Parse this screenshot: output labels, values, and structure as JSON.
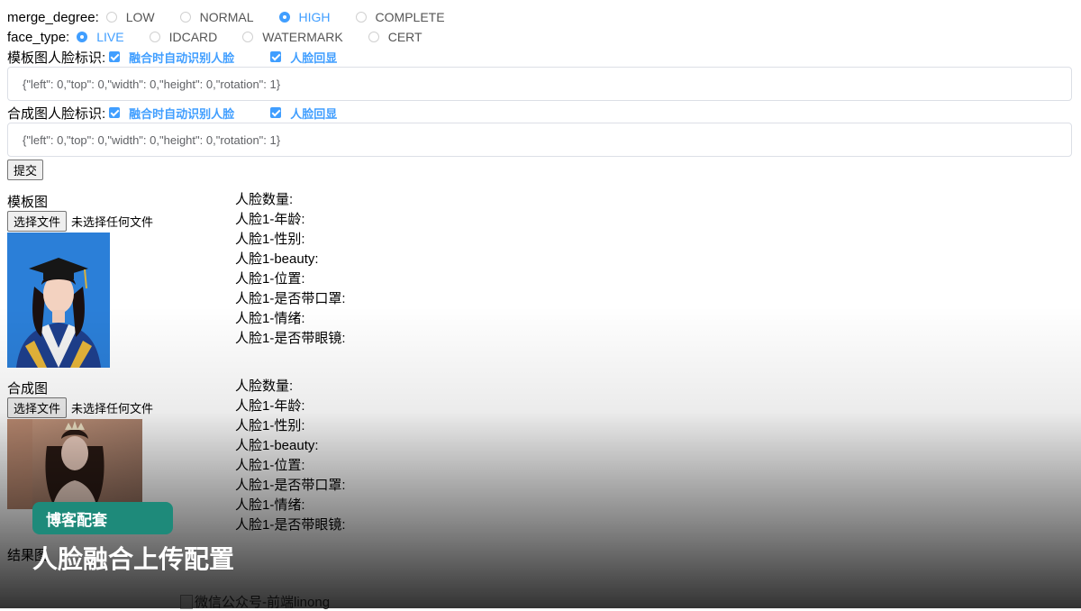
{
  "merge_degree": {
    "label": "merge_degree:",
    "options": [
      {
        "label": "LOW",
        "checked": false
      },
      {
        "label": "NORMAL",
        "checked": false
      },
      {
        "label": "HIGH",
        "checked": true
      },
      {
        "label": "COMPLETE",
        "checked": false
      }
    ]
  },
  "face_type": {
    "label": "face_type:",
    "options": [
      {
        "label": "LIVE",
        "checked": true
      },
      {
        "label": "IDCARD",
        "checked": false
      },
      {
        "label": "WATERMARK",
        "checked": false
      },
      {
        "label": "CERT",
        "checked": false
      }
    ]
  },
  "template_face": {
    "label": "模板图人脸标识:",
    "auto_detect": "融合时自动识别人脸",
    "echo": "人脸回显",
    "value": "{\"left\": 0,\"top\": 0,\"width\": 0,\"height\": 0,\"rotation\": 1}"
  },
  "merge_face": {
    "label": "合成图人脸标识:",
    "auto_detect": "融合时自动识别人脸",
    "echo": "人脸回显",
    "value": "{\"left\": 0,\"top\": 0,\"width\": 0,\"height\": 0,\"rotation\": 1}"
  },
  "submit_label": "提交",
  "template_image": {
    "title": "模板图",
    "file_button": "选择文件",
    "file_status": "未选择任何文件"
  },
  "merge_image": {
    "title": "合成图",
    "file_button": "选择文件",
    "file_status": "未选择任何文件"
  },
  "face_info_labels": [
    "人脸数量:",
    "人脸1-年龄:",
    "人脸1-性别:",
    "人脸1-beauty:",
    "人脸1-位置:",
    "人脸1-是否带口罩:",
    "人脸1-情绪:",
    "人脸1-是否带眼镜:"
  ],
  "result_label": "结果图",
  "broken_image_alt": "微信公众号-前端linong",
  "overlay": {
    "badge": "博客配套",
    "headline": "人脸融合上传配置"
  },
  "colors": {
    "accent": "#409eff",
    "badge": "#1e8a7a"
  }
}
